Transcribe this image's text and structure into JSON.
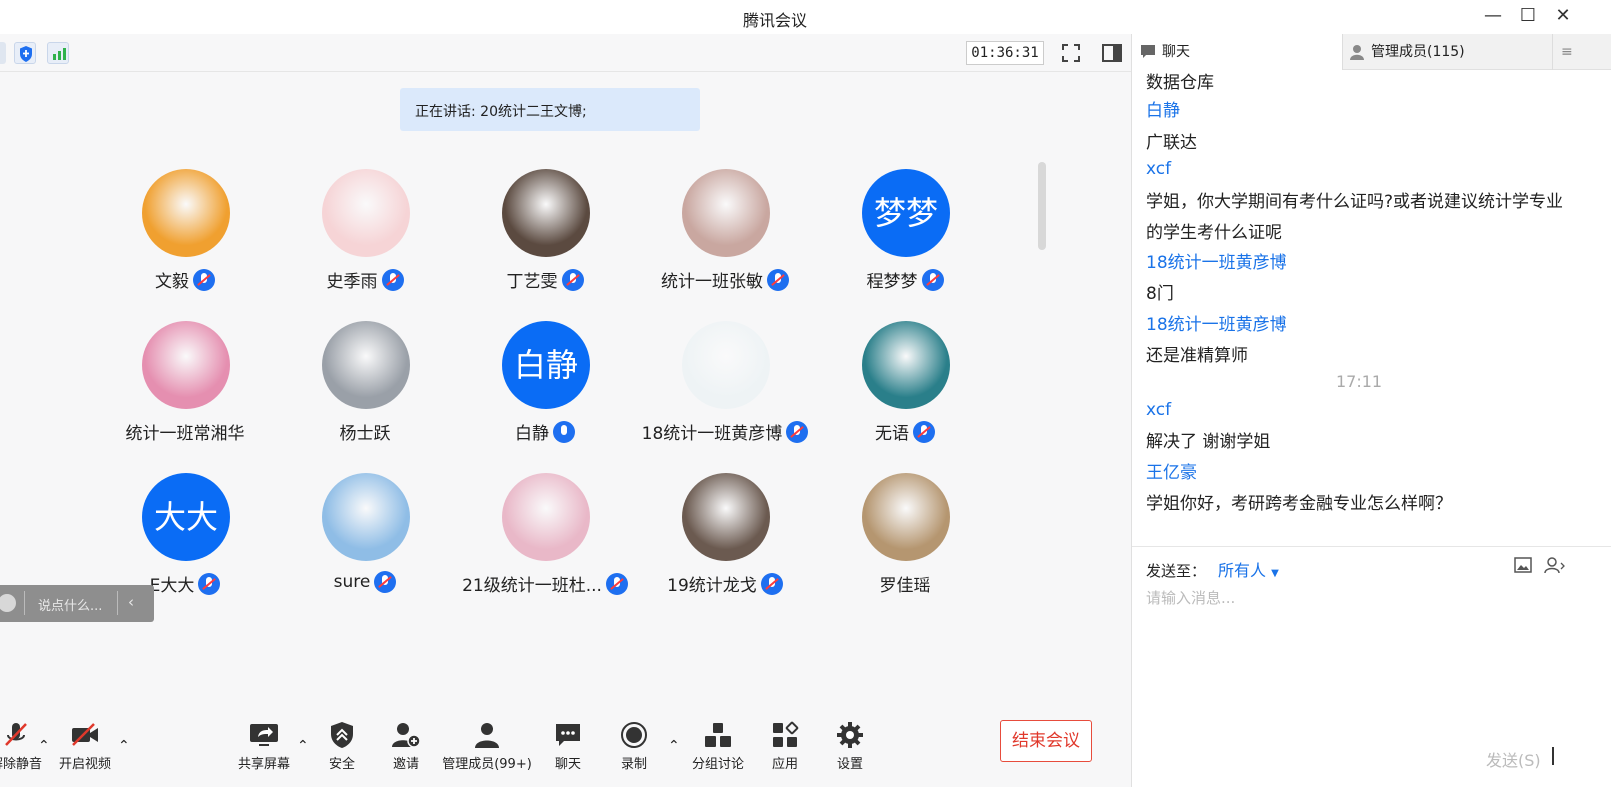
{
  "window": {
    "title": "腾讯会议"
  },
  "toolbar": {
    "timer": "01:36:31"
  },
  "speaking": {
    "text": "正在讲话: 20统计二王文博;"
  },
  "participants": [
    {
      "name": "文毅",
      "mic": "on",
      "avatar": "photo",
      "color": "#f0a030"
    },
    {
      "name": "史季雨",
      "mic": "on",
      "avatar": "photo",
      "color": "#f6d4d6"
    },
    {
      "name": "丁艺雯",
      "mic": "on",
      "avatar": "photo",
      "color": "#5b4a40"
    },
    {
      "name": "统计一班张敏",
      "mic": "on",
      "avatar": "photo",
      "color": "#c9a7a0"
    },
    {
      "name": "程梦梦",
      "mic": "on",
      "avatar": "text",
      "avatar_text": "梦梦"
    },
    {
      "name": "统计一班常湘华",
      "mic": "none",
      "avatar": "photo",
      "color": "#e58fb0"
    },
    {
      "name": "杨士跃",
      "mic": "none",
      "avatar": "photo",
      "color": "#9aa0a8"
    },
    {
      "name": "白静",
      "mic": "active",
      "avatar": "text",
      "avatar_text": "白静"
    },
    {
      "name": "18统计一班黄彦博",
      "mic": "on",
      "avatar": "photo",
      "color": "#eef3f5"
    },
    {
      "name": "无语",
      "mic": "on",
      "avatar": "photo",
      "color": "#2a7f8a"
    },
    {
      "name": "E大大",
      "mic": "on",
      "avatar": "text",
      "avatar_text": "大大"
    },
    {
      "name": "sure",
      "mic": "on",
      "avatar": "photo",
      "color": "#8fbde6"
    },
    {
      "name": "21级统计一班杜...",
      "mic": "on",
      "avatar": "photo",
      "color": "#e9b8c8"
    },
    {
      "name": "19统计龙戈",
      "mic": "on",
      "avatar": "photo",
      "color": "#6b5a50"
    },
    {
      "name": "罗佳瑶",
      "mic": "none",
      "avatar": "photo",
      "color": "#b59670"
    }
  ],
  "chat_bubble": {
    "placeholder": "说点什么..."
  },
  "bottom": {
    "mute": "解除静音",
    "video": "开启视频",
    "share": "共享屏幕",
    "security": "安全",
    "invite": "邀请",
    "members": "管理成员(99+)",
    "chat": "聊天",
    "record": "录制",
    "breakout": "分组讨论",
    "apps": "应用",
    "settings": "设置",
    "end": "结束会议"
  },
  "right_panel": {
    "tab_chat": "聊天",
    "tab_members": "管理成员(115)",
    "messages": [
      {
        "kind": "text",
        "text": "数据仓库"
      },
      {
        "kind": "sender",
        "text": "白静"
      },
      {
        "kind": "text",
        "text": "广联达"
      },
      {
        "kind": "sender",
        "text": "xcf"
      },
      {
        "kind": "text",
        "text": "学姐，你大学期间有考什么证吗?或者说建议统计学专业"
      },
      {
        "kind": "text",
        "text": "的学生考什么证呢"
      },
      {
        "kind": "sender",
        "text": "18统计一班黄彦博"
      },
      {
        "kind": "text",
        "text": "8门"
      },
      {
        "kind": "sender",
        "text": "18统计一班黄彦博"
      },
      {
        "kind": "text",
        "text": "还是准精算师"
      },
      {
        "kind": "time",
        "text": "17:11"
      },
      {
        "kind": "sender",
        "text": "xcf"
      },
      {
        "kind": "text",
        "text": "解决了 谢谢学姐"
      },
      {
        "kind": "sender",
        "text": "王亿豪"
      },
      {
        "kind": "text",
        "text": "学姐你好，考研跨考金融专业怎么样啊？"
      }
    ],
    "send_to_label": "发送至：",
    "send_to_value": "所有人",
    "input_placeholder": "请输入消息...",
    "send_button": "发送(S)"
  }
}
